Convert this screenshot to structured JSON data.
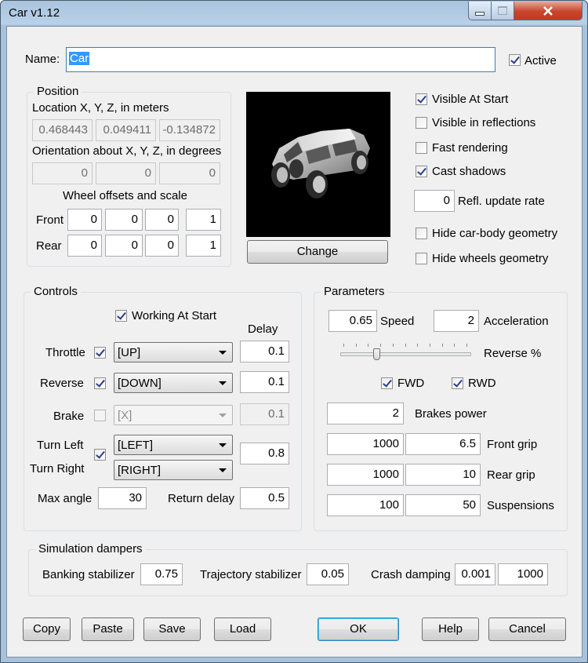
{
  "window": {
    "title": "Car v1.12",
    "minimize_icon": "minimize-icon",
    "maximize_icon": "maximize-icon",
    "close_icon": "close-icon"
  },
  "name": {
    "label": "Name:",
    "value": "Car",
    "active_label": "Active",
    "active_checked": true
  },
  "position": {
    "group_title": "Position",
    "location_label": "Location X, Y, Z,  in meters",
    "location": [
      "0.468443",
      "0.049411",
      "-0.134872"
    ],
    "orientation_label": "Orientation about X, Y, Z, in degrees",
    "orientation": [
      "0",
      "0",
      "0"
    ],
    "wheel_label": "Wheel offsets and scale",
    "front_label": "Front",
    "front": [
      "0",
      "0",
      "0",
      "1"
    ],
    "rear_label": "Rear",
    "rear": [
      "0",
      "0",
      "0",
      "1"
    ]
  },
  "preview": {
    "change_label": "Change"
  },
  "options": {
    "visible_at_start": {
      "label": "Visible At Start",
      "checked": true
    },
    "visible_in_reflections": {
      "label": "Visible in reflections",
      "checked": false
    },
    "fast_rendering": {
      "label": "Fast rendering",
      "checked": false
    },
    "cast_shadows": {
      "label": "Cast shadows",
      "checked": true
    },
    "refl_update_rate": {
      "label": "Refl. update rate",
      "value": "0"
    },
    "hide_car_body": {
      "label": "Hide car-body geometry",
      "checked": false
    },
    "hide_wheels": {
      "label": "Hide wheels geometry",
      "checked": false
    }
  },
  "controls": {
    "group_title": "Controls",
    "working_at_start": {
      "label": "Working At Start",
      "checked": true
    },
    "delay_header": "Delay",
    "throttle": {
      "label": "Throttle",
      "checked": true,
      "key": "[UP]",
      "delay": "0.1"
    },
    "reverse": {
      "label": "Reverse",
      "checked": true,
      "key": "[DOWN]",
      "delay": "0.1"
    },
    "brake": {
      "label": "Brake",
      "checked": false,
      "key": "[X]",
      "delay": "0.1"
    },
    "turn_left": {
      "label": "Turn Left",
      "key": "[LEFT]"
    },
    "turn_right": {
      "label": "Turn Right",
      "key": "[RIGHT]"
    },
    "turn_checked": true,
    "turn_delay": "0.8",
    "max_angle_label": "Max angle",
    "max_angle": "30",
    "return_delay_label": "Return delay",
    "return_delay": "0.5"
  },
  "parameters": {
    "group_title": "Parameters",
    "speed": {
      "value": "0.65",
      "label": "Speed"
    },
    "acceleration": {
      "value": "2",
      "label": "Acceleration"
    },
    "reverse_pct_label": "Reverse %",
    "reverse_pct_fraction": 0.27,
    "fwd": {
      "label": "FWD",
      "checked": true
    },
    "rwd": {
      "label": "RWD",
      "checked": true
    },
    "brakes_power": {
      "value": "2",
      "label": "Brakes power"
    },
    "front_grip": {
      "values": [
        "1000",
        "6.5"
      ],
      "label": "Front grip"
    },
    "rear_grip": {
      "values": [
        "1000",
        "10"
      ],
      "label": "Rear grip"
    },
    "suspensions": {
      "values": [
        "100",
        "50"
      ],
      "label": "Suspensions"
    }
  },
  "dampers": {
    "group_title": "Simulation dampers",
    "banking": {
      "label": "Banking stabilizer",
      "value": "0.75"
    },
    "trajectory": {
      "label": "Trajectory stabilizer",
      "value": "0.05"
    },
    "crash": {
      "label": "Crash damping",
      "values": [
        "0.001",
        "1000"
      ]
    }
  },
  "buttons": {
    "copy": "Copy",
    "paste": "Paste",
    "save": "Save",
    "load": "Load",
    "ok": "OK",
    "help": "Help",
    "cancel": "Cancel"
  },
  "colors": {
    "accent": "#3399ff",
    "checkmark": "#2a3f8e",
    "title_bar": "#b9d1e8",
    "close_button": "#c8452c"
  }
}
